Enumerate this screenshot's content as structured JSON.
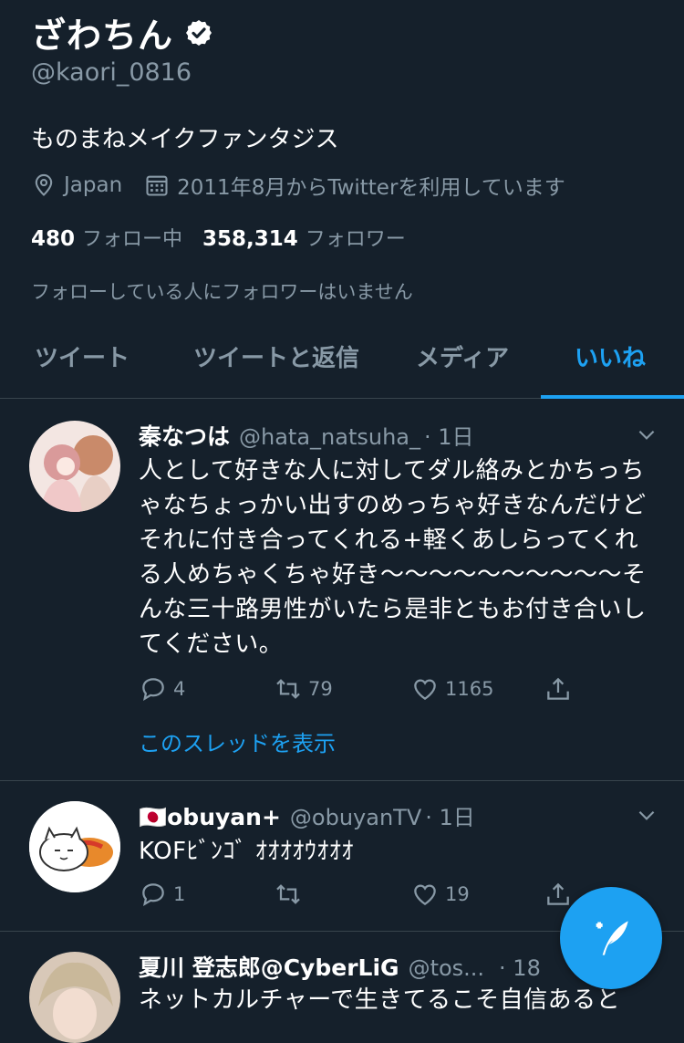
{
  "profile": {
    "display_name": "ざわちん",
    "handle": "@kaori_0816",
    "bio": "ものまねメイクファンタジス",
    "location": "Japan",
    "joined": "2011年8月からTwitterを利用しています",
    "following_count": "480",
    "following_label": "フォロー中",
    "followers_count": "358,314",
    "followers_label": "フォロワー",
    "followers_you_know": "フォローしている人にフォロワーはいません"
  },
  "tabs": [
    {
      "label": "ツイート",
      "active": false
    },
    {
      "label": "ツイートと返信",
      "active": false
    },
    {
      "label": "メディア",
      "active": false
    },
    {
      "label": "いいね",
      "active": true
    }
  ],
  "tweets": [
    {
      "author": "秦なつは",
      "handle": "@hata_natsuha_",
      "time": "· 1日",
      "text": "人として好きな人に対してダル絡みとかちっちゃなちょっかい出すのめっちゃ好きなんだけどそれに付き合ってくれる+軽くあしらってくれる人めちゃくちゃ好き〜〜〜〜〜〜〜〜〜〜そんな三十路男性がいたら是非ともお付き合いしてください。",
      "replies": "4",
      "retweets": "79",
      "likes": "1165",
      "thread_link": "このスレッドを表示"
    },
    {
      "author": "🇯🇵obuyan+",
      "handle": "@obuyanTV",
      "time": "· 1日",
      "text": "KOFﾋﾞﾝｺﾞ ｵｵｵｵｳｵｵｵ",
      "replies": "1",
      "retweets": "",
      "likes": "19"
    },
    {
      "author": "夏川 登志郎@CyberLiG",
      "handle": "@tos...",
      "time": "· 18",
      "text": "ネットカルチャーで生きてるこそ自信あると"
    }
  ],
  "colors": {
    "background": "#15202b",
    "accent": "#1da1f2",
    "muted": "#8899a6",
    "divider": "#38444d"
  }
}
